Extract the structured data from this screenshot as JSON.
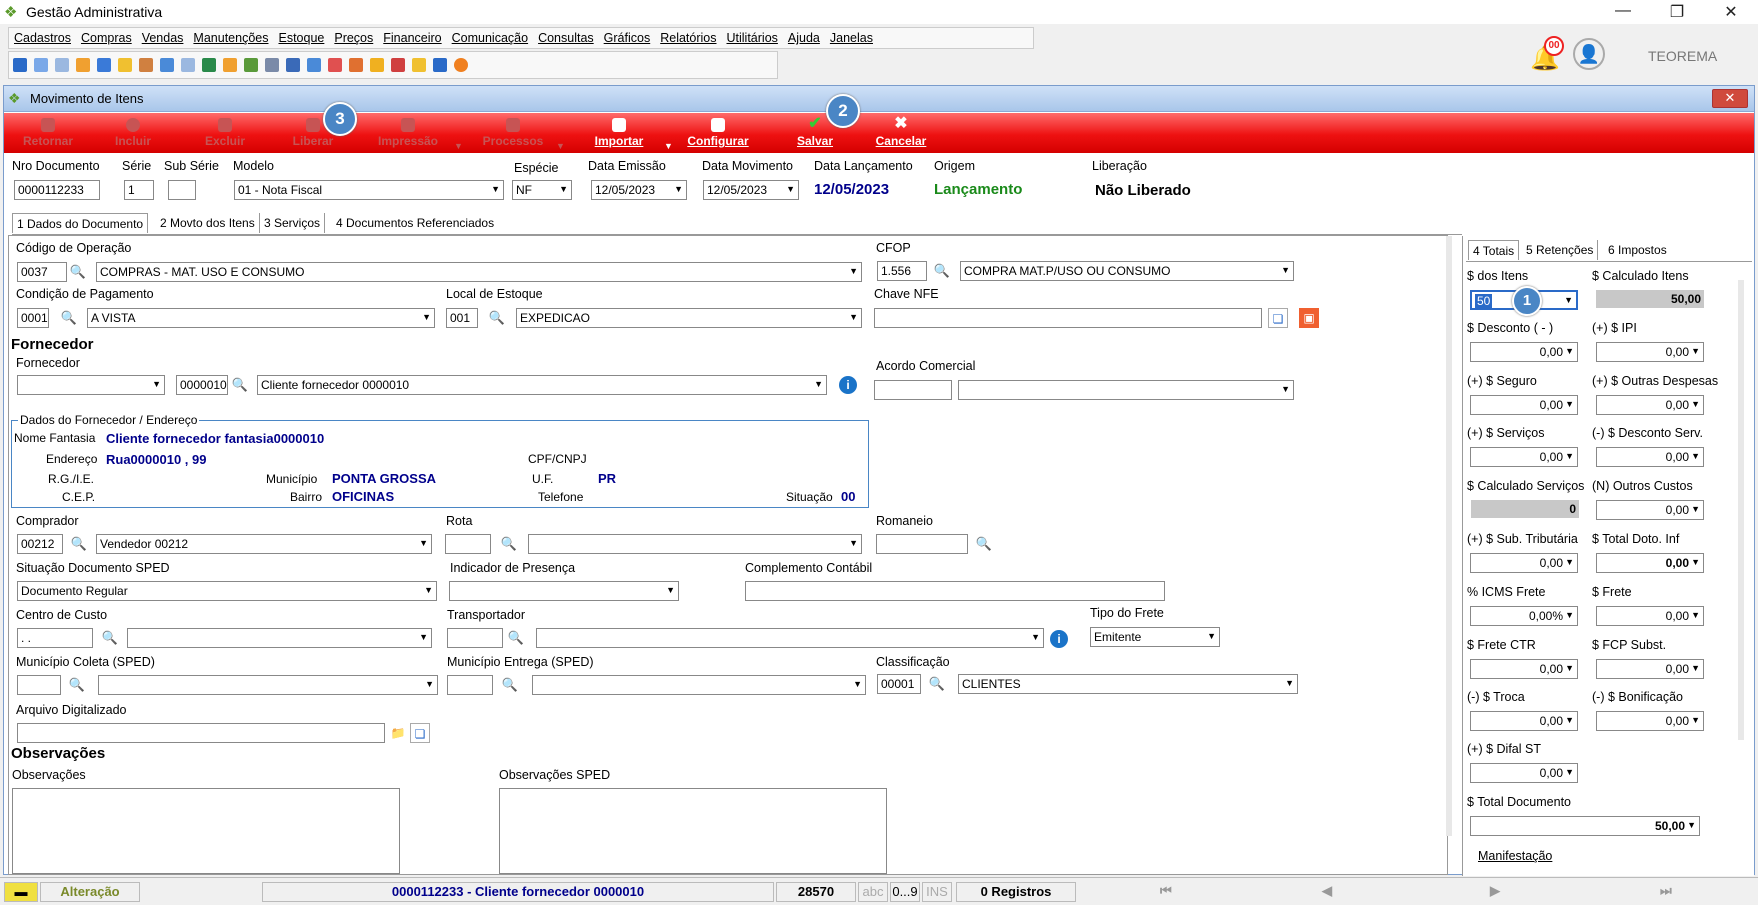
{
  "app": {
    "title": "Gestão Administrativa",
    "user": "TEOREMA",
    "notifications": "00"
  },
  "menu": [
    "Cadastros",
    "Compras",
    "Vendas",
    "Manutenções",
    "Estoque",
    "Preços",
    "Financeiro",
    "Comunicação",
    "Consultas",
    "Gráficos",
    "Relatórios",
    "Utilitários",
    "Ajuda",
    "Janelas"
  ],
  "window": {
    "title": "Movimento de Itens"
  },
  "actions": {
    "retornar": "Retornar",
    "incluir": "Incluir",
    "excluir": "Excluir",
    "liberar": "Liberar",
    "impressao": "Impressão",
    "processos": "Processos",
    "importar": "Importar",
    "configurar": "Configurar",
    "salvar": "Salvar",
    "cancelar": "Cancelar"
  },
  "badges": {
    "b1": "1",
    "b2": "2",
    "b3": "3"
  },
  "header": {
    "nro_label": "Nro Documento",
    "nro": "0000112233",
    "serie_label": "Série",
    "serie": "1",
    "subserie_label": "Sub Série",
    "subserie": "",
    "modelo_label": "Modelo",
    "modelo": "01 - Nota Fiscal",
    "especie_label": "Espécie",
    "especie": "NF",
    "emissao_label": "Data Emissão",
    "emissao": "12/05/2023",
    "movimento_label": "Data Movimento",
    "movimento": "12/05/2023",
    "lancamento_label": "Data Lançamento",
    "lancamento": "12/05/2023",
    "origem_label": "Origem",
    "origem": "Lançamento",
    "liberacao_label": "Liberação",
    "liberacao": "Não Liberado"
  },
  "tabs": [
    "1 Dados do Documento",
    "2 Movto dos Itens",
    "3 Serviços",
    "4 Documentos Referenciados"
  ],
  "form": {
    "cod_op_label": "Código de Operação",
    "cod_op": "0037",
    "cod_op_desc": "COMPRAS  - MAT. USO E CONSUMO",
    "cfop_label": "CFOP",
    "cfop": "1.556",
    "cfop_desc": "COMPRA MAT.P/USO OU CONSUMO",
    "cond_label": "Condição de Pagamento",
    "cond": "0001",
    "cond_desc": "A VISTA",
    "local_label": "Local de Estoque",
    "local": "001",
    "local_desc": "EXPEDICAO",
    "chave_label": "Chave NFE",
    "chave": "",
    "fornecedor_section": "Fornecedor",
    "fornecedor_label": "Fornecedor",
    "fornecedor_code": "0000010",
    "fornecedor_name": "Cliente fornecedor 0000010",
    "acordo_label": "Acordo Comercial",
    "dados_title": "Dados do Fornecedor / Endereço",
    "fantasia_label": "Nome Fantasia",
    "fantasia": "Cliente fornecedor fantasia0000010",
    "endereco_label": "Endereço",
    "endereco": "Rua0000010 , 99",
    "cpf_label": "CPF/CNPJ",
    "cpf": "",
    "rg_label": "R.G./I.E.",
    "municipio_label": "Município",
    "municipio": "PONTA GROSSA",
    "uf_label": "U.F.",
    "uf": "PR",
    "cep_label": "C.E.P.",
    "bairro_label": "Bairro",
    "bairro": "OFICINAS",
    "telefone_label": "Telefone",
    "situacao_label": "Situação",
    "situacao": "00",
    "comprador_label": "Comprador",
    "comprador": "00212",
    "comprador_desc": "Vendedor 00212",
    "rota_label": "Rota",
    "romaneio_label": "Romaneio",
    "sit_sped_label": "Situação Documento SPED",
    "sit_sped": "Documento Regular",
    "presenca_label": "Indicador de Presença",
    "compl_label": "Complemento Contábil",
    "centro_label": "Centro de Custo",
    "centro": " .  .",
    "transp_label": "Transportador",
    "frete_tipo_label": "Tipo do Frete",
    "frete_tipo": "Emitente",
    "mun_coleta_label": "Município Coleta (SPED)",
    "mun_entrega_label": "Município Entrega (SPED)",
    "classif_label": "Classificação",
    "classif": "00001",
    "classif_desc": "CLIENTES",
    "arquivo_label": "Arquivo Digitalizado",
    "obs_section": "Observações",
    "obs_label": "Observações",
    "obs_sped_label": "Observações SPED"
  },
  "panel": {
    "tabs": [
      "4 Totais",
      "5 Retenções",
      "6 Impostos"
    ],
    "dos_itens_label": "$ dos Itens",
    "dos_itens": "50",
    "calc_itens_label": "$ Calculado Itens",
    "calc_itens": "50,00",
    "desconto_label": "$ Desconto ( - )",
    "desconto": "0,00",
    "ipi_label": "(+) $ IPI",
    "ipi": "0,00",
    "seguro_label": "(+) $ Seguro",
    "seguro": "0,00",
    "outras_label": "(+) $ Outras Despesas",
    "outras": "0,00",
    "servicos_label": "(+) $ Serviços",
    "servicos": "0,00",
    "desc_serv_label": "(-) $ Desconto Serv.",
    "desc_serv": "0,00",
    "calc_serv_label": "$ Calculado Serviços",
    "calc_serv": "0",
    "outros_custos_label": "(N) Outros Custos",
    "outros_custos": "0,00",
    "sub_trib_label": "(+) $ Sub. Tributária",
    "sub_trib": "0,00",
    "total_inf_label": "$ Total Doto. Inf",
    "total_inf": "0,00",
    "icms_frete_label": "% ICMS Frete",
    "icms_frete": "0,00%",
    "frete_label": "$ Frete",
    "frete": "0,00",
    "frete_ctr_label": "$ Frete CTR",
    "frete_ctr": "0,00",
    "fcp_label": "$ FCP Subst.",
    "fcp": "0,00",
    "troca_label": "(-) $ Troca",
    "troca": "0,00",
    "bonif_label": "(-) $ Bonificação",
    "bonif": "0,00",
    "difal_label": "(+) $ Difal ST",
    "difal": "0,00",
    "total_doc_label": "$ Total Documento",
    "total_doc": "50,00",
    "manifest_label": "Manifestação"
  },
  "status": {
    "mode": "Alteração",
    "doc": "0000112233 - Cliente fornecedor 0000010",
    "num": "28570",
    "abc": "abc",
    "range": "0...9",
    "ins": "INS",
    "registros": "0 Registros"
  },
  "colors": {
    "accent": "#ee1111",
    "blue": "#00008b",
    "green": "#1a8a1a"
  }
}
